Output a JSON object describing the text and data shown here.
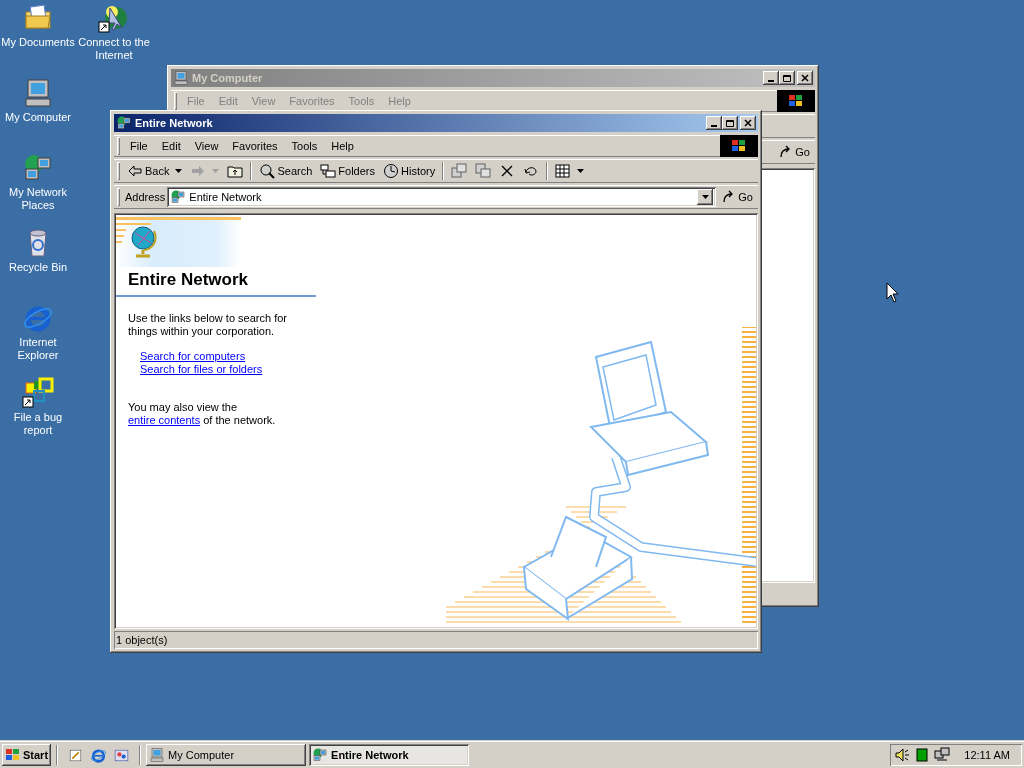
{
  "desktop_icons": [
    {
      "kind": "documents",
      "label": "My Documents",
      "shortcut": false
    },
    {
      "kind": "connect",
      "label": "Connect to the Internet",
      "shortcut": true
    },
    {
      "kind": "computer",
      "label": "My Computer",
      "shortcut": false
    },
    {
      "kind": "network",
      "label": "My Network Places",
      "shortcut": false
    },
    {
      "kind": "recycle",
      "label": "Recycle Bin",
      "shortcut": false
    },
    {
      "kind": "browser",
      "label": "Internet Explorer",
      "shortcut": false
    },
    {
      "kind": "bug",
      "label": "File a bug report",
      "shortcut": true
    }
  ],
  "windows": [
    {
      "title": "My Computer",
      "active": false,
      "menu": [
        "File",
        "Edit",
        "View",
        "Favorites",
        "Tools",
        "Help"
      ],
      "go": "Go"
    },
    {
      "title": "Entire Network",
      "active": true,
      "menu": [
        "File",
        "Edit",
        "View",
        "Favorites",
        "Tools",
        "Help"
      ],
      "toolbar": [
        {
          "kind": "back",
          "label": "Back",
          "disabled": false
        },
        {
          "kind": "forward",
          "disabled": true
        },
        {
          "kind": "up",
          "disabled": false
        },
        {
          "kind": "separator"
        },
        {
          "kind": "search",
          "label": "Search",
          "disabled": false
        },
        {
          "kind": "folders",
          "label": "Folders",
          "disabled": false
        },
        {
          "kind": "history",
          "label": "History",
          "disabled": false
        },
        {
          "kind": "separator"
        },
        {
          "kind": "moveto",
          "disabled": false
        },
        {
          "kind": "copyto",
          "disabled": false
        },
        {
          "kind": "delete",
          "disabled": false
        },
        {
          "kind": "undo",
          "disabled": false
        },
        {
          "kind": "separator"
        },
        {
          "kind": "views",
          "disabled": false
        }
      ],
      "address_label": "Address",
      "address": "Entire Network",
      "go": "Go",
      "content": {
        "heading": "Entire Network",
        "intro": "Use the links below to search for things within your corporation.",
        "links": [
          "Search for computers",
          "Search for files or folders"
        ],
        "more": {
          "before": "You may also view the",
          "link": "entire contents",
          "after": "of the network."
        }
      },
      "status": "1 object(s)"
    }
  ],
  "taskbar": {
    "start": "Start",
    "tasks": [
      {
        "label": "My Computer",
        "kind": "computer",
        "selected": false
      },
      {
        "label": "Entire Network",
        "kind": "network",
        "selected": true
      }
    ],
    "clock": "12:11 AM"
  }
}
